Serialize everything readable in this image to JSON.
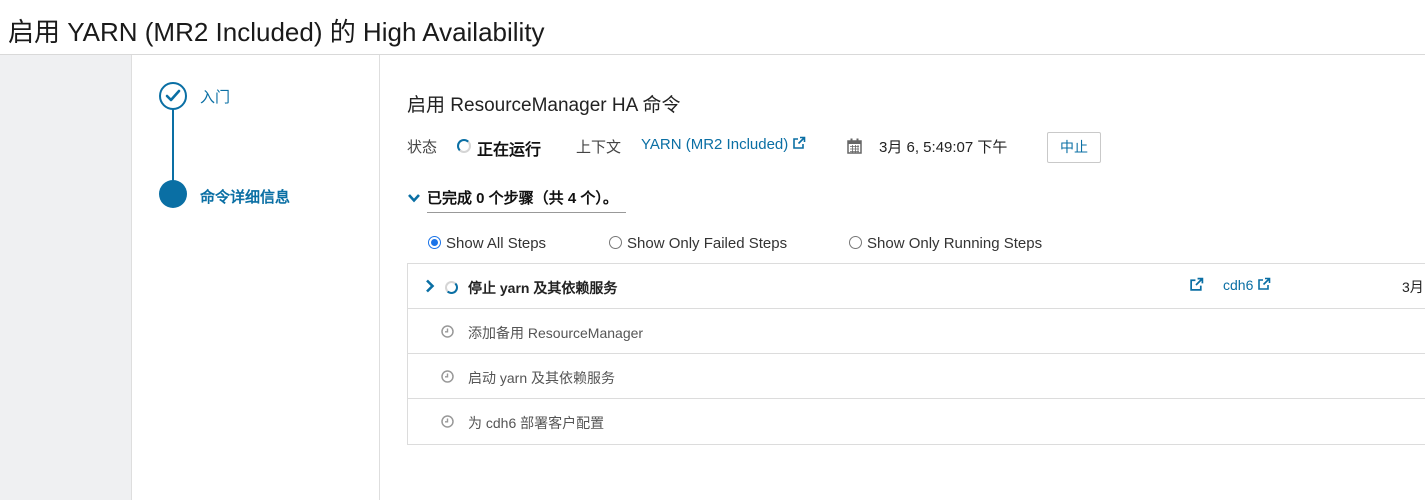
{
  "header": {
    "title": "启用 YARN (MR2 Included) 的 High Availability"
  },
  "wizard": {
    "steps": [
      {
        "label": "入门",
        "state": "done"
      },
      {
        "label": "命令详细信息",
        "state": "active"
      }
    ]
  },
  "command": {
    "title": "启用 ResourceManager HA 命令",
    "status_label": "状态",
    "status_value": "正在运行",
    "context_label": "上下文",
    "context_value": "YARN (MR2 Included)",
    "time_value": "3月 6, 5:49:07 下午",
    "abort_label": "中止"
  },
  "progress": {
    "summary": "已完成 0 个步骤（共 4 个）。"
  },
  "filters": {
    "options": [
      "Show All Steps",
      "Show Only Failed Steps",
      "Show Only Running Steps"
    ],
    "selected": "Show All Steps"
  },
  "steps": [
    {
      "label": "停止 yarn 及其依赖服务",
      "state": "running",
      "host": "cdh6",
      "date": "3月"
    },
    {
      "label": "添加备用 ResourceManager",
      "state": "pending"
    },
    {
      "label": "启动 yarn 及其依赖服务",
      "state": "pending"
    },
    {
      "label": "为 cdh6 部署客户配置",
      "state": "pending"
    }
  ],
  "colors": {
    "accent": "#0a6fa4",
    "radio": "#1a73e8",
    "sidebar_bg": "#eff0f2"
  },
  "icons": [
    "check-icon",
    "external-link-icon",
    "calendar-icon",
    "chevron-down-icon",
    "chevron-right-icon",
    "clock-icon",
    "spinner-icon"
  ]
}
